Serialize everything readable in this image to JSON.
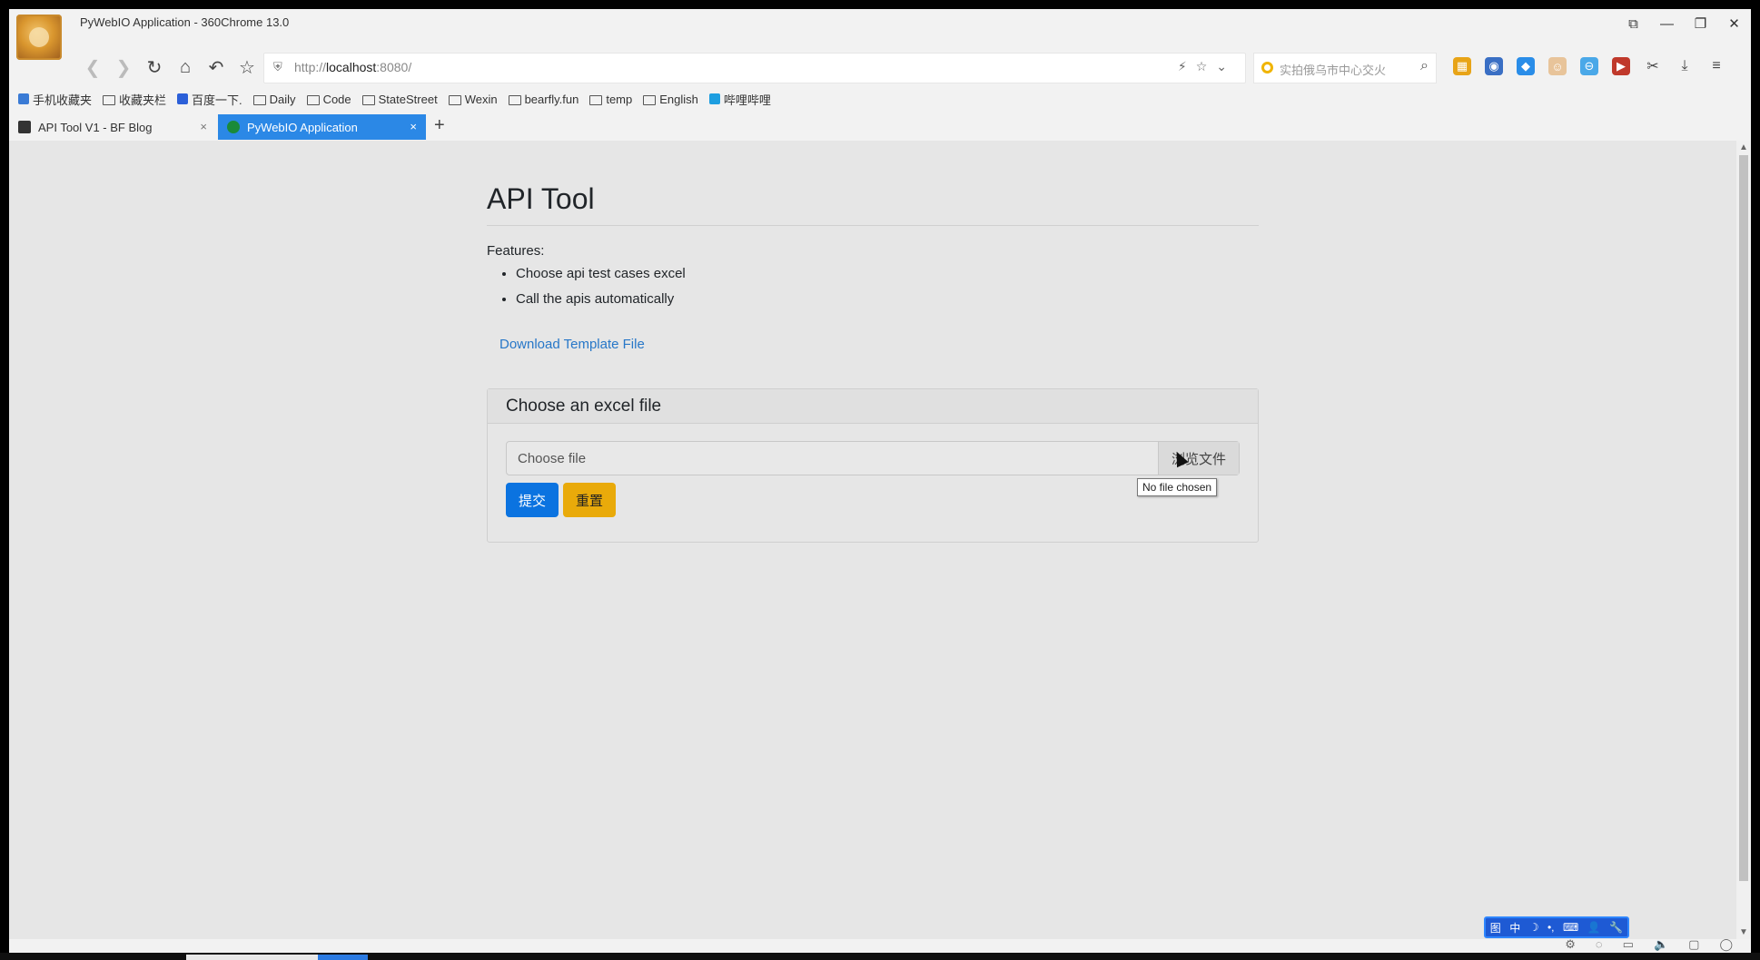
{
  "window": {
    "title": "PyWebIO Application - 360Chrome 13.0",
    "controls": [
      "⧉",
      "—",
      "❐",
      "✕"
    ]
  },
  "nav": {
    "back": "❮",
    "forward": "❯",
    "reload": "↻",
    "home": "⌂",
    "undo": "↶",
    "favorite": "☆",
    "url_prefix": "http://",
    "url_host": "localhost",
    "url_rest": ":8080/",
    "url_right_icons": "⚡☆⌄",
    "search_placeholder": "实拍俄乌市中心交火",
    "search_icon": "⌕"
  },
  "extensions": [
    {
      "name": "apps-icon",
      "glyph": "▦",
      "color": "#e8a417"
    },
    {
      "name": "eye-icon",
      "glyph": "◉",
      "color": "#3a6fc4"
    },
    {
      "name": "ext-blue-icon",
      "glyph": "◆",
      "color": "#2a8de8"
    },
    {
      "name": "cat-icon",
      "glyph": "☺",
      "color": "#e8c49a"
    },
    {
      "name": "minus-circle-icon",
      "glyph": "⊖",
      "color": "#4aa8e8"
    },
    {
      "name": "video-icon",
      "glyph": "▶",
      "color": "#c0392b"
    },
    {
      "name": "scissors-icon",
      "glyph": "✂",
      "color": "#444444"
    },
    {
      "name": "download-icon",
      "glyph": "⤓",
      "color": "#444444"
    },
    {
      "name": "menu-icon",
      "glyph": "≡",
      "color": "#444444"
    }
  ],
  "bookmarks": [
    {
      "label": "手机收藏夹",
      "type": "mobile"
    },
    {
      "label": "收藏夹栏",
      "type": "folder"
    },
    {
      "label": "百度一下.",
      "type": "baidu"
    },
    {
      "label": "Daily",
      "type": "folder"
    },
    {
      "label": "Code",
      "type": "folder"
    },
    {
      "label": "StateStreet",
      "type": "folder"
    },
    {
      "label": "Wexin",
      "type": "folder"
    },
    {
      "label": "bearfly.fun",
      "type": "folder"
    },
    {
      "label": "temp",
      "type": "folder"
    },
    {
      "label": "English",
      "type": "folder"
    },
    {
      "label": "哔哩哔哩",
      "type": "bilibili"
    }
  ],
  "tabs": [
    {
      "label": "API Tool V1 - BF Blog",
      "close": "×"
    },
    {
      "label": "PyWebIO Application",
      "close": "×"
    }
  ],
  "new_tab": "+",
  "page": {
    "title": "API Tool",
    "features_label": "Features:",
    "features": [
      "Choose api test cases excel",
      "Call the apis automatically"
    ],
    "download_link": "Download Template File",
    "card_title": "Choose an excel file",
    "file_placeholder": "Choose file",
    "browse_label": "浏览文件",
    "submit_label": "提交",
    "reset_label": "重置",
    "tooltip": "No file chosen"
  },
  "scrollbar": {
    "up": "▲",
    "down": "▼"
  },
  "ime": [
    "中",
    "☽",
    "•,",
    "⌨",
    "👤",
    "🔧"
  ],
  "ime_logo": "图",
  "system_tray": [
    "⚙",
    "◌",
    "▭",
    "🔈",
    "▢",
    "◯"
  ],
  "colors": {
    "accent": "#2b88e6",
    "primary_button": "#0b73e0",
    "warning_button": "#e9aa0a",
    "link": "#2777c8",
    "page_bg": "#e6e6e6"
  }
}
